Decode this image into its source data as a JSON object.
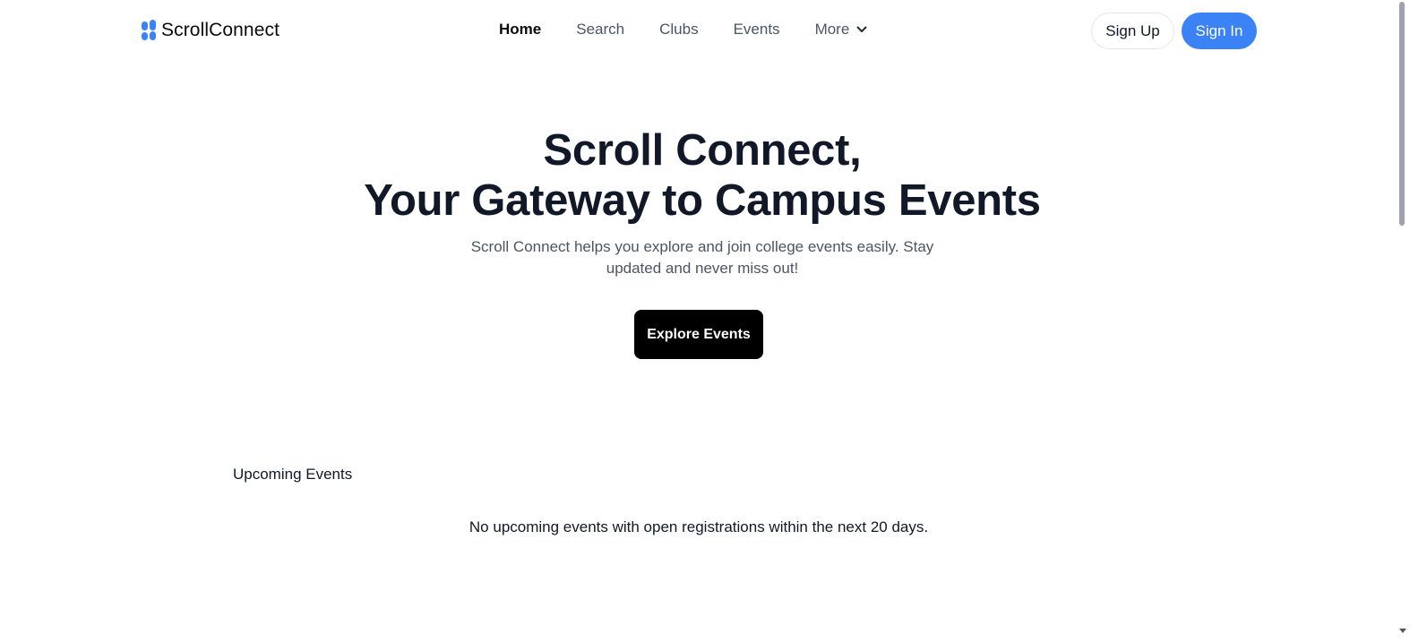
{
  "brand": {
    "name": "ScrollConnect"
  },
  "nav": {
    "home": "Home",
    "search": "Search",
    "clubs": "Clubs",
    "events": "Events",
    "more": "More"
  },
  "auth": {
    "sign_up": "Sign Up",
    "sign_in": "Sign In"
  },
  "hero": {
    "title_line1": "Scroll Connect,",
    "title_line2": "Your Gateway to Campus Events",
    "subtitle": "Scroll Connect helps you explore and join college events easily. Stay updated and never miss out!",
    "cta": "Explore Events"
  },
  "upcoming": {
    "heading": "Upcoming Events",
    "empty_message": "No upcoming events with open registrations within the next 20 days."
  },
  "colors": {
    "accent": "#3b82f6",
    "cta_bg": "#000000"
  }
}
